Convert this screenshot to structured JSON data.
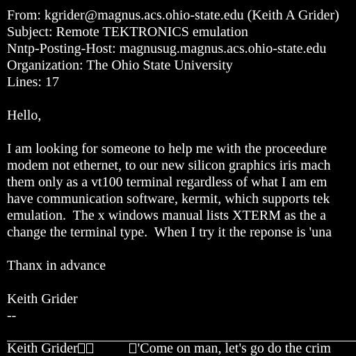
{
  "headers": {
    "from": "From: kgrider@magnus.acs.ohio-state.edu (Keith A Grider)",
    "subject": "Subject: Remote TEKTRONICS emulation",
    "nntp_host": "Nntp-Posting-Host: magnusug.magnus.acs.ohio-state.edu",
    "organization": "Organization: The Ohio State University",
    "lines": "Lines: 17"
  },
  "body": {
    "greeting": "Hello,",
    "paragraph": [
      "I am looking for someone to help me with the proceedure",
      "modem not ethernet, to our new silicon graphics iris mach",
      "them only as a vt100 terminal regardless of what I am em",
      "have communication software, kermit, which supports tek",
      "emulation.  The x windows manual lists XTERM as the a",
      "change the terminal type.  When I try it the reponse is 'una"
    ],
    "closing": "Thanx in advance",
    "signoff_name": "Keith Grider",
    "sig_separator": "--"
  },
  "signature": {
    "name": "Keith Grider",
    "quote": "'Come on man, let's go do the crim"
  }
}
